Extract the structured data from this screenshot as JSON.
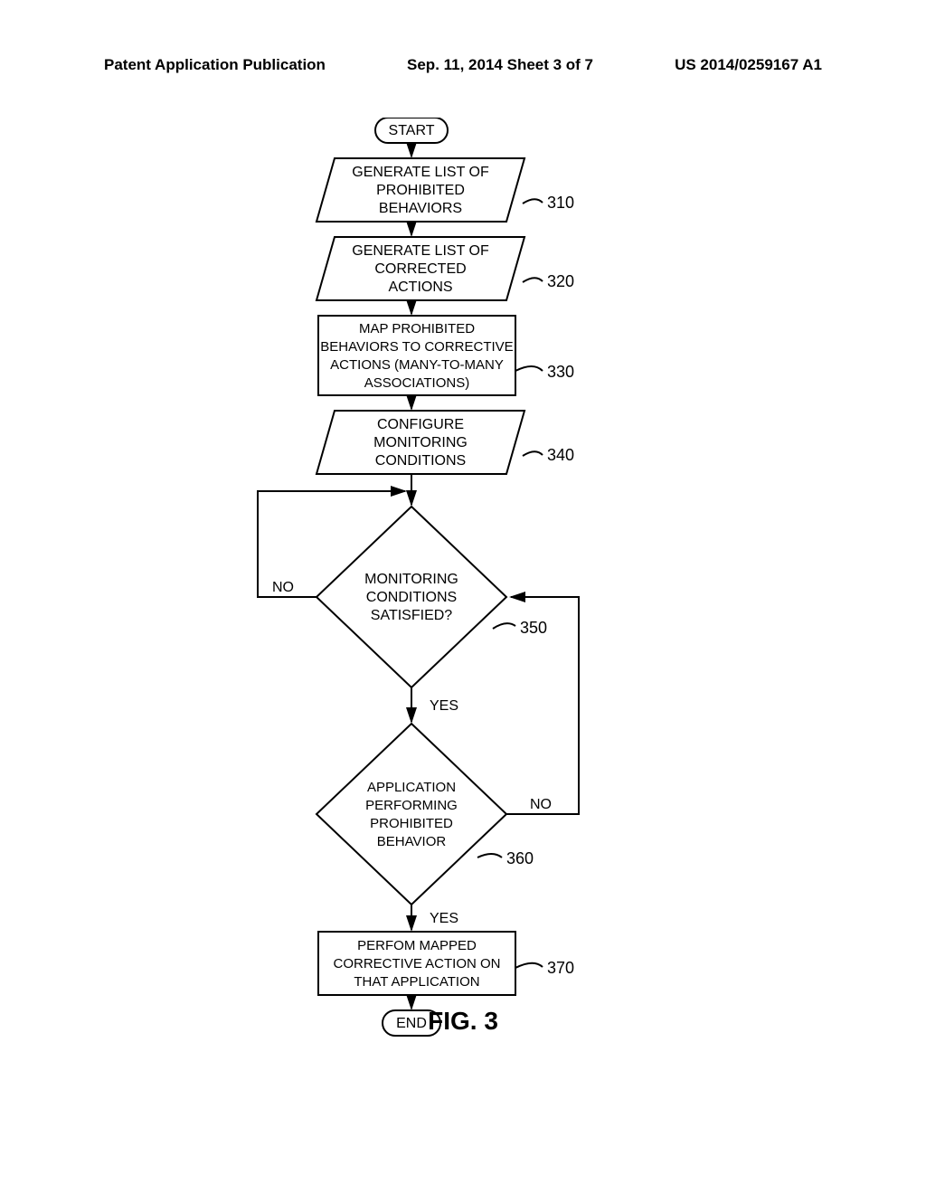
{
  "header": {
    "left": "Patent Application Publication",
    "center": "Sep. 11, 2014  Sheet 3 of 7",
    "right": "US 2014/0259167 A1"
  },
  "flowchart": {
    "start": "START",
    "box310": {
      "line1": "GENERATE LIST OF",
      "line2": "PROHIBITED",
      "line3": "BEHAVIORS",
      "ref": "310"
    },
    "box320": {
      "line1": "GENERATE LIST OF",
      "line2": "CORRECTED",
      "line3": "ACTIONS",
      "ref": "320"
    },
    "box330": {
      "line1": "MAP PROHIBITED",
      "line2": "BEHAVIORS TO CORRECTIVE",
      "line3": "ACTIONS (MANY-TO-MANY",
      "line4": "ASSOCIATIONS)",
      "ref": "330"
    },
    "box340": {
      "line1": "CONFIGURE",
      "line2": "MONITORING",
      "line3": "CONDITIONS",
      "ref": "340"
    },
    "dec350": {
      "line1": "MONITORING",
      "line2": "CONDITIONS",
      "line3": "SATISFIED?",
      "ref": "350",
      "no": "NO",
      "yes": "YES"
    },
    "dec360": {
      "line1": "APPLICATION",
      "line2": "PERFORMING",
      "line3": "PROHIBITED",
      "line4": "BEHAVIOR",
      "ref": "360",
      "no": "NO",
      "yes": "YES"
    },
    "box370": {
      "line1": "PERFOM MAPPED",
      "line2": "CORRECTIVE ACTION ON",
      "line3": "THAT APPLICATION",
      "ref": "370"
    },
    "end": "END"
  },
  "figure_label": "FIG. 3"
}
